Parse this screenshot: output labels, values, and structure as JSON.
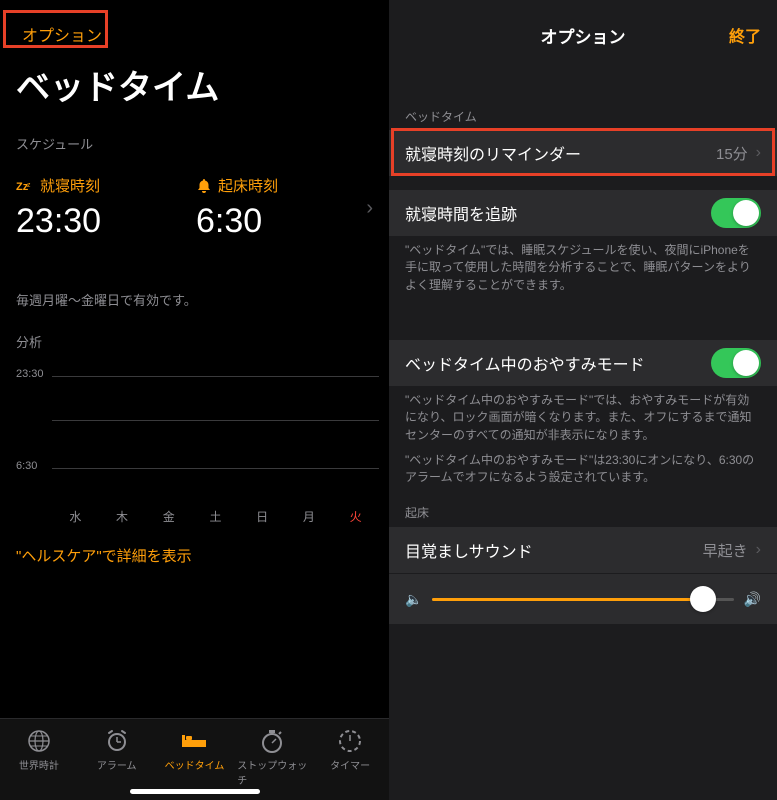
{
  "left": {
    "options_link": "オプション",
    "title": "ベッドタイム",
    "schedule_label": "スケジュール",
    "bed_label": "就寝時刻",
    "bed_time": "23:30",
    "wake_label": "起床時刻",
    "wake_time": "6:30",
    "schedule_note": "毎週月曜〜金曜日で有効です。",
    "analysis_label": "分析",
    "y_top": "23:30",
    "y_bottom": "6:30",
    "days": [
      "水",
      "木",
      "金",
      "土",
      "日",
      "月",
      "火"
    ],
    "healthcare": "\"ヘルスケア\"で詳細を表示",
    "tabs": {
      "world": "世界時計",
      "alarm": "アラーム",
      "bed": "ベッドタイム",
      "stop": "ストップウォッチ",
      "timer": "タイマー"
    }
  },
  "right": {
    "nav_title": "オプション",
    "done": "終了",
    "group1": "ベッドタイム",
    "reminder_label": "就寝時刻のリマインダー",
    "reminder_value": "15分",
    "track_label": "就寝時間を追跡",
    "track_footer": "\"ベッドタイム\"では、睡眠スケジュールを使い、夜間にiPhoneを手に取って使用した時間を分析することで、睡眠パターンをよりよく理解することができます。",
    "dnd_label": "ベッドタイム中のおやすみモード",
    "dnd_footer1": "\"ベッドタイム中のおやすみモード\"では、おやすみモードが有効になり、ロック画面が暗くなります。また、オフにするまで通知センターのすべての通知が非表示になります。",
    "dnd_footer2": "\"ベッドタイム中のおやすみモード\"は23:30にオンになり、6:30のアラームでオフになるよう設定されています。",
    "group2": "起床",
    "sound_label": "目覚ましサウンド",
    "sound_value": "早起き"
  }
}
